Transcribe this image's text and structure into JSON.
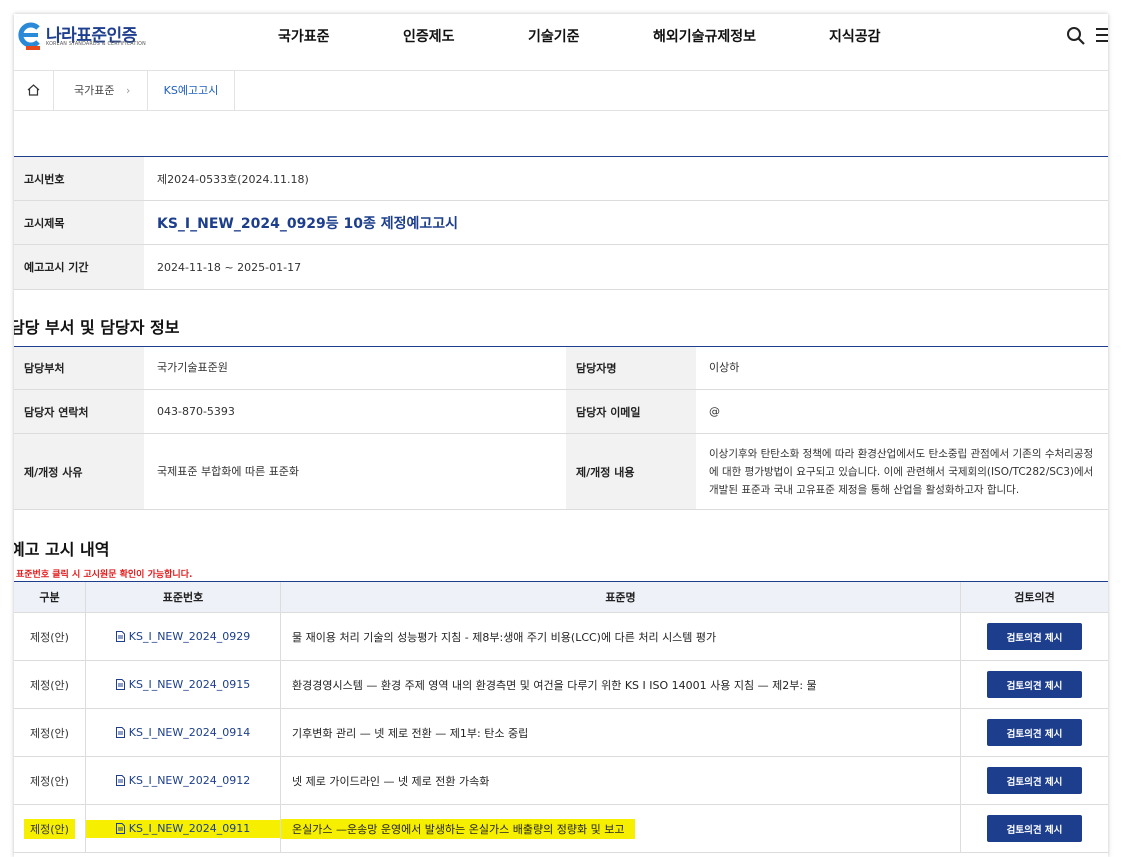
{
  "header": {
    "logo_text": "나라표준인증",
    "logo_sub": "KOREAN STANDARDS & CERTIFICATION",
    "nav": [
      "국가표준",
      "인증제도",
      "기술기준",
      "해외기술규제정보",
      "지식공감"
    ]
  },
  "breadcrumb": {
    "items": [
      "국가표준",
      "KS예고고시"
    ]
  },
  "notice": {
    "rows": [
      {
        "label": "고시번호",
        "value": "제2024-0533호(2024.11.18)"
      },
      {
        "label": "고시제목",
        "value": "KS_I_NEW_2024_0929등 10종 제정예고고시"
      },
      {
        "label": "예고고시 기간",
        "value": "2024-11-18 ~ 2025-01-17"
      }
    ]
  },
  "contact": {
    "title": "담당 부서 및 담당자 정보",
    "dept_label": "담당부처",
    "dept_value": "국가기술표준원",
    "person_label": "담당자명",
    "person_value": "이상하",
    "phone_label": "담당자 연락처",
    "phone_value": "043-870-5393",
    "email_label": "담당자 이메일",
    "email_value": "@",
    "reason_label": "제/개정 사유",
    "reason_value": "국제표준 부합화에 따른 표준화",
    "content_label": "제/개정 내용",
    "content_value": "이상기후와 탄탄소화 정책에 따라 환경산업에서도 탄소중립 관점에서 기존의 수처리공정에 대한 평가방법이 요구되고 있습니다. 이에 관련해서 국제회의(ISO/TC282/SC3)에서 개발된 표준과 국내 고유표준 제정을 통해 산업을 활성화하고자 합니다."
  },
  "list": {
    "title": "예고 고시 내역",
    "note": "표준번호 클릭 시 고시원문 확인이 가능합니다.",
    "headers": [
      "구분",
      "표준번호",
      "표준명",
      "검토의견"
    ],
    "button_label": "검토의견 제시",
    "rows": [
      {
        "type": "제정(안)",
        "number": "KS_I_NEW_2024_0929",
        "name": "물 재이용 처리 기술의 성능평가 지침 - 제8부:생애 주기 비용(LCC)에 다른 처리 시스템 평가"
      },
      {
        "type": "제정(안)",
        "number": "KS_I_NEW_2024_0915",
        "name": "환경경영시스템 — 환경 주제 영역 내의 환경측면 및 여건을 다루기 위한 KS I ISO 14001 사용 지침 — 제2부: 물"
      },
      {
        "type": "제정(안)",
        "number": "KS_I_NEW_2024_0914",
        "name": "기후변화 관리 — 넷 제로 전환 — 제1부: 탄소 중립"
      },
      {
        "type": "제정(안)",
        "number": "KS_I_NEW_2024_0912",
        "name": "넷 제로 가이드라인 — 넷 제로 전환 가속화"
      },
      {
        "type": "제정(안)",
        "number": "KS_I_NEW_2024_0911",
        "name": "온실가스 —운송망 운영에서 발생하는 온실가스 배출량의 정량화 및 보고"
      }
    ]
  },
  "colors": {
    "brand": "#1c3e8c",
    "highlight": "#f6f000",
    "note": "#e31b1b"
  }
}
